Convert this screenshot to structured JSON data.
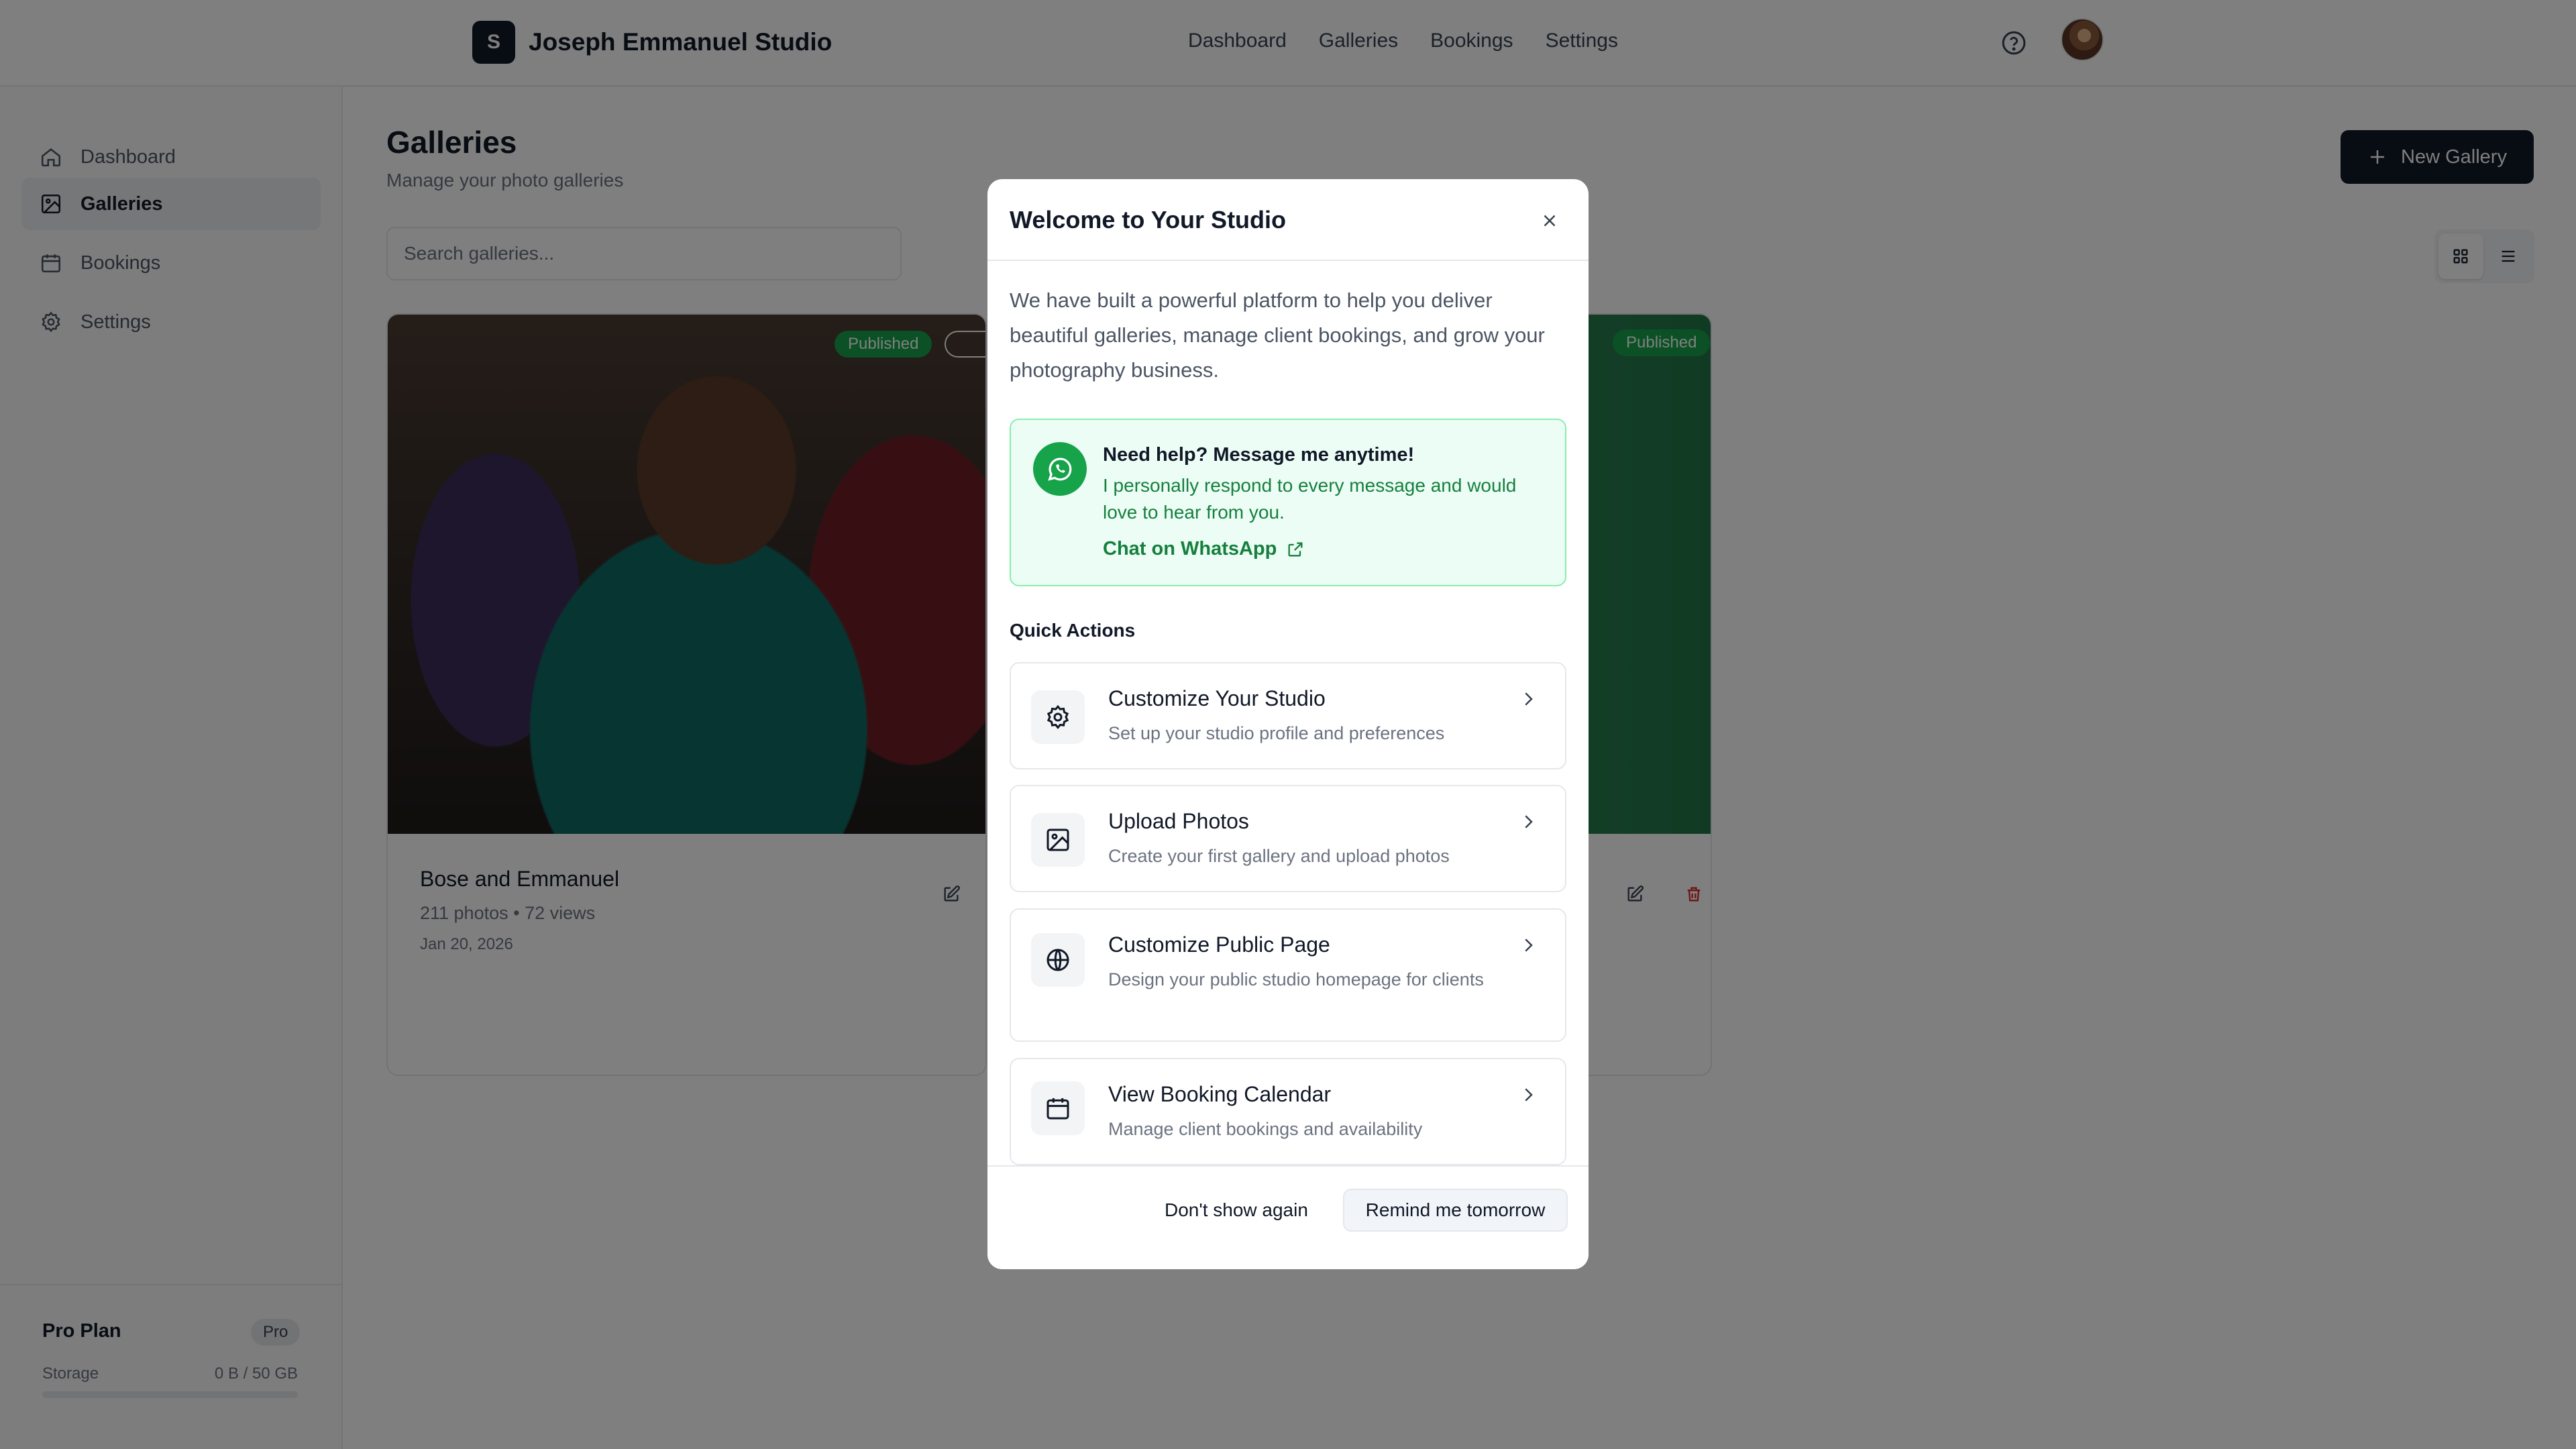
{
  "app": {
    "brand_initial": "S",
    "brand_name": "Joseph Emmanuel Studio",
    "top_nav": [
      "Dashboard",
      "Galleries",
      "Bookings",
      "Settings"
    ]
  },
  "sidebar": {
    "items": [
      {
        "label": "Dashboard",
        "icon": "home-icon",
        "active": false
      },
      {
        "label": "Galleries",
        "icon": "image-icon",
        "active": true
      },
      {
        "label": "Bookings",
        "icon": "calendar-icon",
        "active": false
      },
      {
        "label": "Settings",
        "icon": "gear-icon",
        "active": false
      }
    ],
    "plan": {
      "title": "Pro Plan",
      "badge": "Pro",
      "storage_label": "Storage",
      "storage_value": "0 B / 50 GB",
      "storage_used_fraction": 0
    }
  },
  "main": {
    "title": "Galleries",
    "subtitle": "Manage your photo galleries",
    "new_button": "New Gallery",
    "search_placeholder": "Search galleries...",
    "galleries": [
      {
        "name": "Bose and Emmanuel",
        "meta": "211 photos • 72 views",
        "date": "Jan 20, 2026",
        "status": "Published"
      },
      {
        "name": "",
        "meta": "",
        "date": "",
        "status": "Published"
      }
    ]
  },
  "modal": {
    "title": "Welcome to Your Studio",
    "intro": "We have built a powerful platform to help you deliver beautiful galleries, manage client bookings, and grow your photography business.",
    "whatsapp": {
      "title": "Need help? Message me anytime!",
      "body": "I personally respond to every message and would love to hear from you.",
      "link": "Chat on WhatsApp"
    },
    "quick_actions_heading": "Quick Actions",
    "quick_actions": [
      {
        "title": "Customize Your Studio",
        "desc": "Set up your studio profile and preferences",
        "icon": "gear-icon"
      },
      {
        "title": "Upload Photos",
        "desc": "Create your first gallery and upload photos",
        "icon": "image-icon"
      },
      {
        "title": "Customize Public Page",
        "desc": "Design your public studio homepage for clients",
        "icon": "globe-icon"
      },
      {
        "title": "View Booking Calendar",
        "desc": "Manage client bookings and availability",
        "icon": "calendar-icon"
      }
    ],
    "dont_show": "Don't show again",
    "remind": "Remind me tomorrow"
  },
  "colors": {
    "primary": "#111827",
    "success": "#16a34a",
    "whatsapp_bg": "#ecfdf5",
    "danger": "#dc2626"
  }
}
